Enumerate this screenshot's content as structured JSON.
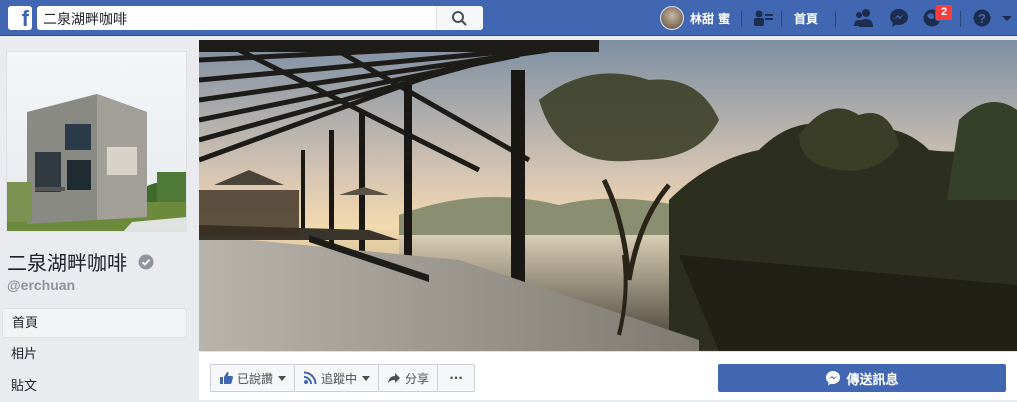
{
  "topbar": {
    "logo": "f",
    "search_value": "二泉湖畔咖啡",
    "user_name": "林甜 蜜",
    "home_label": "首頁",
    "notification_count": "2",
    "brand_color": "#4267b2"
  },
  "page": {
    "name": "二泉湖畔咖啡",
    "username": "@erchuan"
  },
  "sidebar": {
    "items": [
      {
        "label": "首頁"
      },
      {
        "label": "相片"
      },
      {
        "label": "貼文"
      }
    ]
  },
  "actions": {
    "liked_label": "已說讚",
    "following_label": "追蹤中",
    "share_label": "分享",
    "more_label": "···",
    "message_label": "傳送訊息"
  }
}
